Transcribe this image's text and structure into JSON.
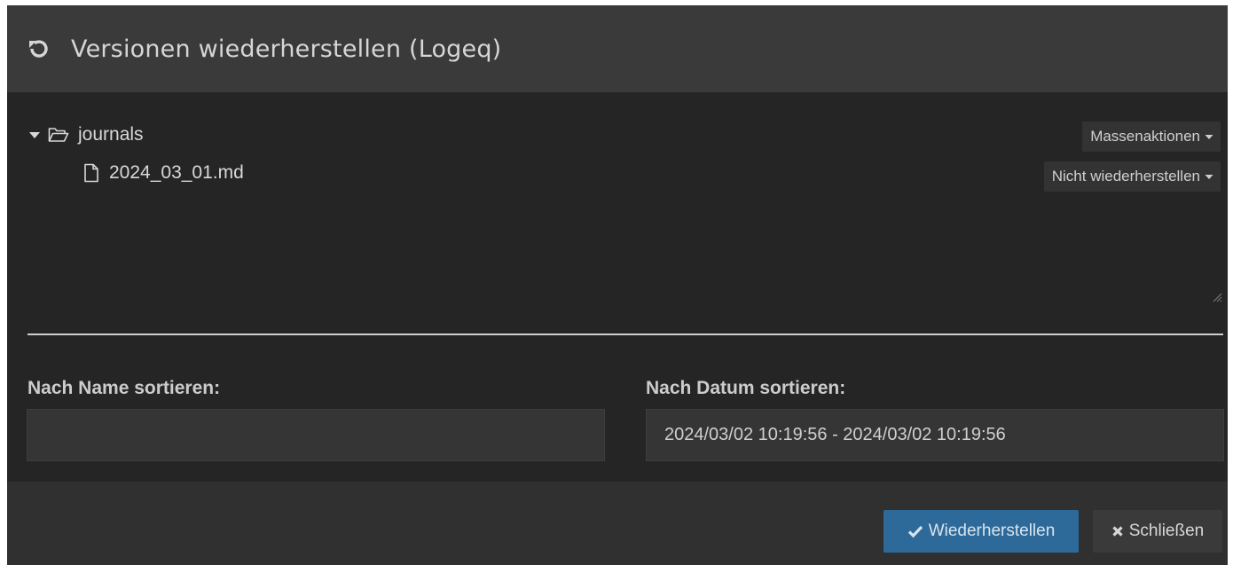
{
  "dialog": {
    "title": "Versionen wiederherstellen (Logeq)",
    "title_icon": "undo-icon"
  },
  "tree": {
    "folder": {
      "name": "journals",
      "icon": "folder-open-icon",
      "expanded": true
    },
    "files": [
      {
        "name": "2024_03_01.md",
        "icon": "file-icon"
      }
    ]
  },
  "actions": {
    "mass_label": "Massenaktionen",
    "restore_mode_label": "Nicht wiederherstellen"
  },
  "sort": {
    "name_label": "Nach Name sortieren:",
    "name_value": "",
    "date_label": "Nach Datum sortieren:",
    "date_value": "2024/03/02 10:19:56 - 2024/03/02 10:19:56"
  },
  "footer": {
    "restore_label": "Wiederherstellen",
    "close_label": "Schließen"
  },
  "colors": {
    "header_bg": "#3a3a3a",
    "body_bg": "#252525",
    "footer_bg": "#303030",
    "primary_button": "#2d6a9a"
  }
}
